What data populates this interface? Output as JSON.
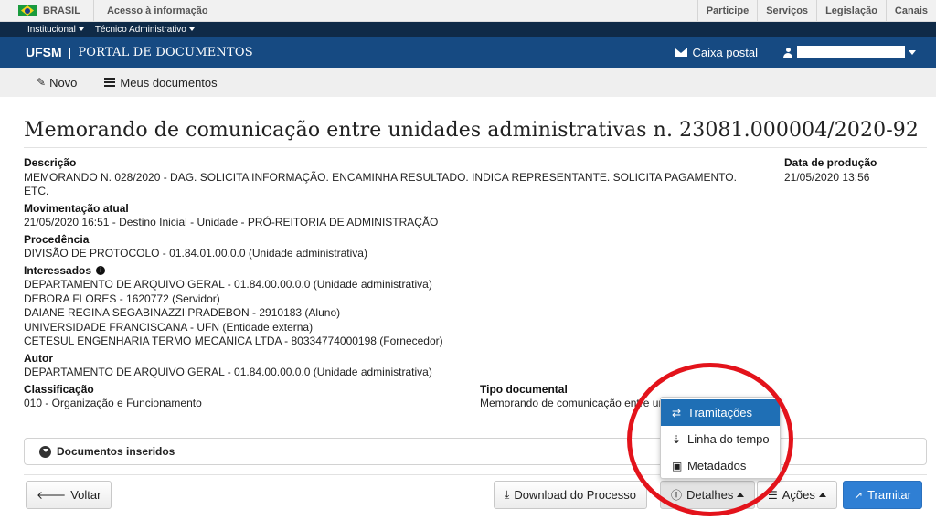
{
  "govbar": {
    "brasil": "BRASIL",
    "acesso": "Acesso à informação",
    "links": [
      "Participe",
      "Serviços",
      "Legislação",
      "Canais"
    ]
  },
  "instbar": {
    "items": [
      "Institucional",
      "Técnico Administrativo"
    ]
  },
  "header": {
    "ufsm": "UFSM",
    "sep": "|",
    "portal": "PORTAL DE DOCUMENTOS",
    "caixa": "Caixa postal"
  },
  "toolbar": {
    "novo": "Novo",
    "meus": "Meus documentos"
  },
  "doc": {
    "title": "Memorando de comunicação entre unidades administrativas n. 23081.000004/2020-92",
    "descricao_label": "Descrição",
    "descricao": "MEMORANDO N. 028/2020 - DAG. SOLICITA INFORMAÇÃO. ENCAMINHA RESULTADO. INDICA REPRESENTANTE. SOLICITA PAGAMENTO. ETC.",
    "producao_label": "Data de produção",
    "producao": "21/05/2020 13:56",
    "mov_label": "Movimentação atual",
    "mov": "21/05/2020 16:51 - Destino Inicial - Unidade - PRÓ-REITORIA DE ADMINISTRAÇÃO",
    "proc_label": "Procedência",
    "proc": "DIVISÃO DE PROTOCOLO - 01.84.01.00.0.0 (Unidade administrativa)",
    "inter_label": "Interessados",
    "interessados": [
      "DEPARTAMENTO DE ARQUIVO GERAL - 01.84.00.00.0.0 (Unidade administrativa)",
      "DEBORA FLORES - 1620772 (Servidor)",
      "DAIANE REGINA SEGABINAZZI PRADEBON - 2910183 (Aluno)",
      "UNIVERSIDADE FRANCISCANA - UFN (Entidade externa)",
      "CETESUL ENGENHARIA TERMO MECANICA LTDA - 80334774000198 (Fornecedor)"
    ],
    "autor_label": "Autor",
    "autor": "DEPARTAMENTO DE ARQUIVO GERAL - 01.84.00.00.0.0 (Unidade administrativa)",
    "class_label": "Classificação",
    "class": "010 - Organização e Funcionamento",
    "tipo_label": "Tipo documental",
    "tipo": "Memorando de comunicação entre unidades administrativas"
  },
  "accordion": "Documentos inseridos",
  "buttons": {
    "voltar": "Voltar",
    "download": "Download do Processo",
    "detalhes": "Detalhes",
    "acoes": "Ações",
    "tramitar": "Tramitar"
  },
  "menu": [
    "Tramitações",
    "Linha do tempo",
    "Metadados"
  ],
  "colors": {
    "header": "#164a82",
    "primary": "#2f7fd4",
    "menu_active": "#1f6fb5",
    "annotation": "#e3131b"
  }
}
